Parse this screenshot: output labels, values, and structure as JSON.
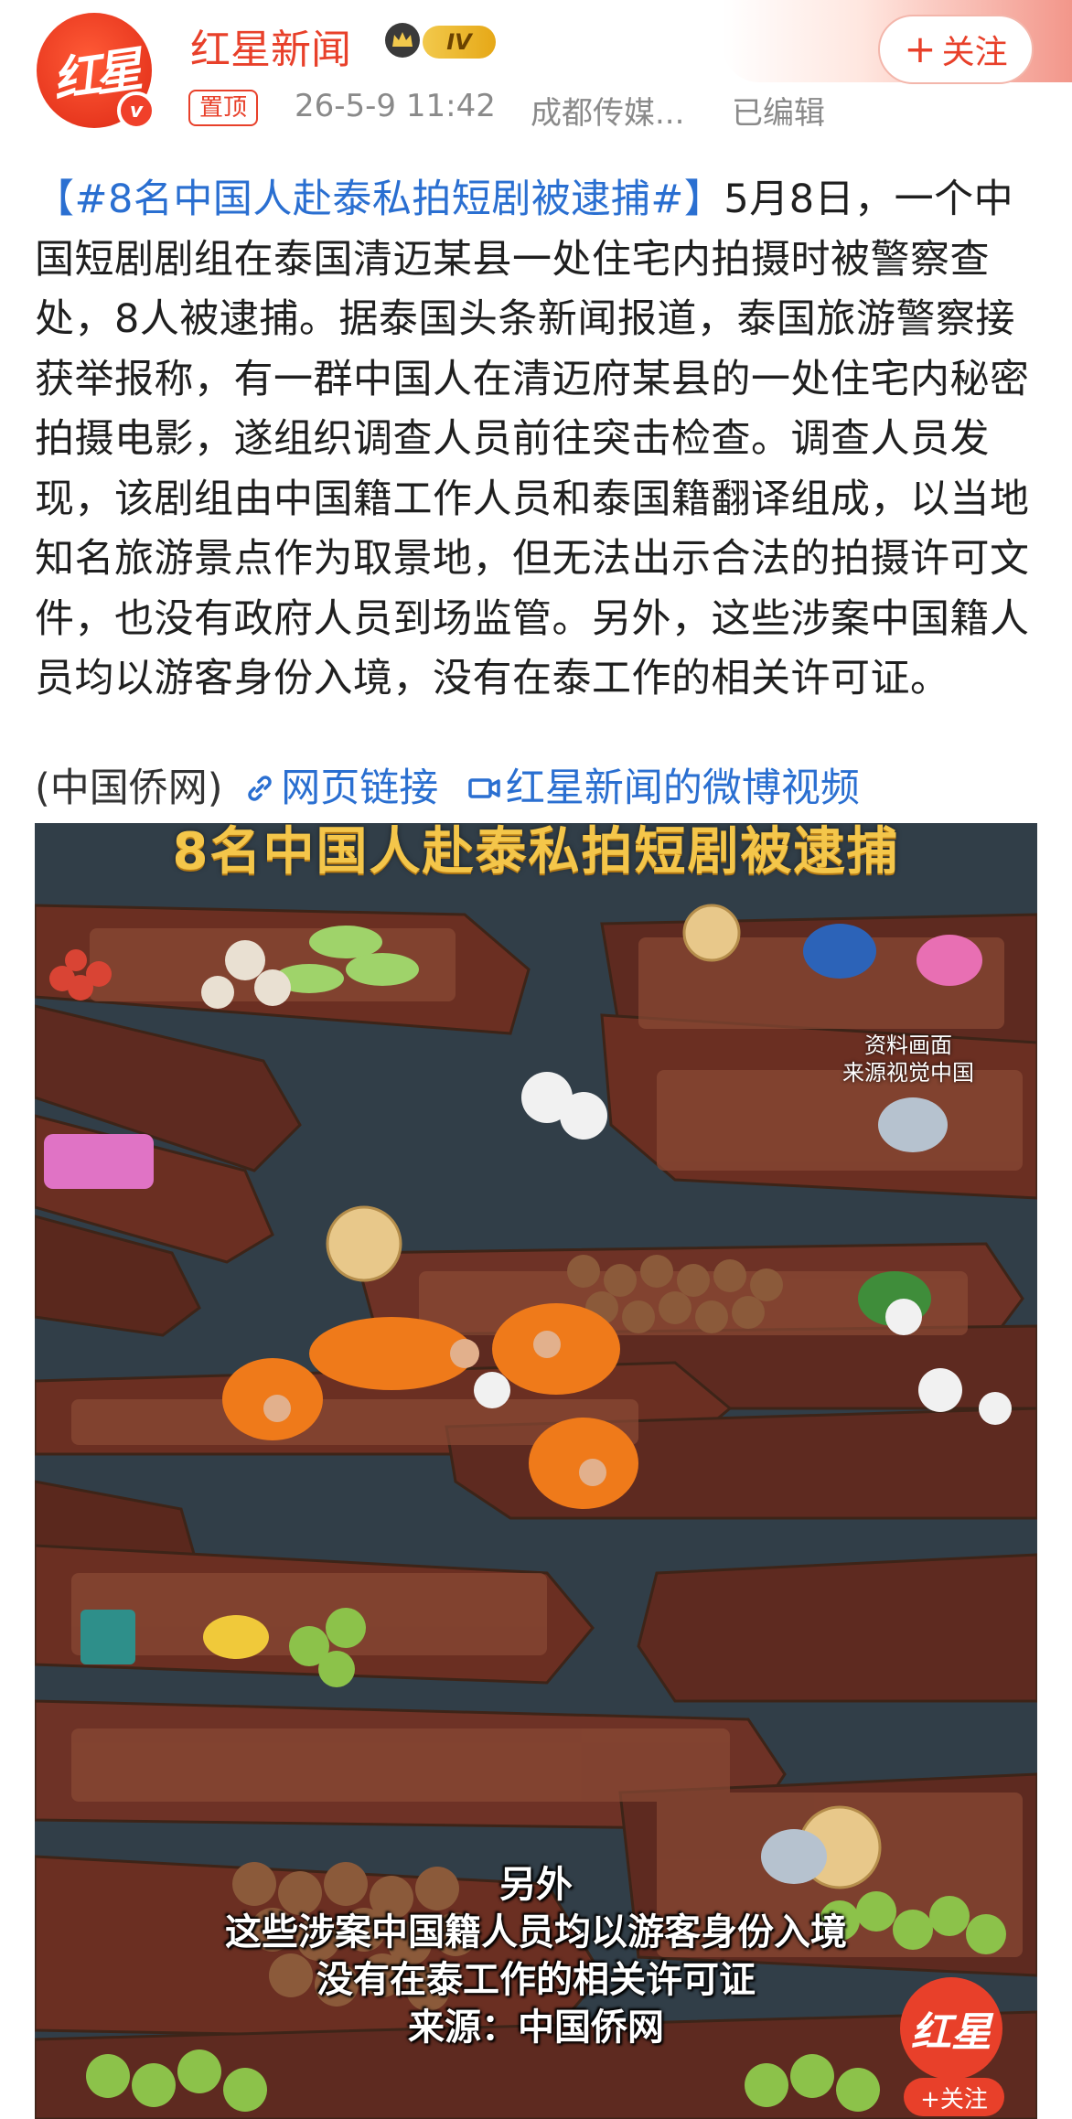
{
  "header": {
    "avatar_text": "红星",
    "verified_mark": "v",
    "account_name": "红星新闻",
    "level_badge": "IV",
    "pin_tag": "置顶",
    "time": "26-5-9 11:42",
    "source": "成都传媒...",
    "edited": "已编辑",
    "follow_plus": "+",
    "follow_label": "关注",
    "accent_color": "#e8402a"
  },
  "post": {
    "hashtag": "【#8名中国人赴泰私拍短剧被逮捕#】",
    "body": "5月8日，一个中国短剧剧组在泰国清迈某县一处住宅内拍摄时被警察查处，8人被逮捕。据泰国头条新闻报道，泰国旅游警察接获举报称，有一群中国人在清迈府某县的一处住宅内秘密拍摄电影，遂组织调查人员前往突击检查。调查人员发现，该剧组由中国籍工作人员和泰国籍翻译组成，以当地知名旅游景点作为取景地，但无法出示合法的拍摄许可文件，也没有政府人员到场监管。另外，这些涉案中国籍人员均以游客身份入境，没有在泰工作的相关许可证。",
    "source_note": "(中国侨网)",
    "web_link": "网页链接",
    "video_link": "红星新闻的微博视频",
    "link_color": "#2a6fd1"
  },
  "video": {
    "title": "8名中国人赴泰私拍短剧被逮捕",
    "watermark_line1": "资料画面",
    "watermark_line2": "来源视觉中国",
    "subtitles": [
      "另外",
      "这些涉案中国籍人员均以游客身份入境",
      "没有在泰工作的相关许可证",
      "来源：中国侨网"
    ],
    "logo_text": "红星",
    "logo_follow": "+关注"
  }
}
